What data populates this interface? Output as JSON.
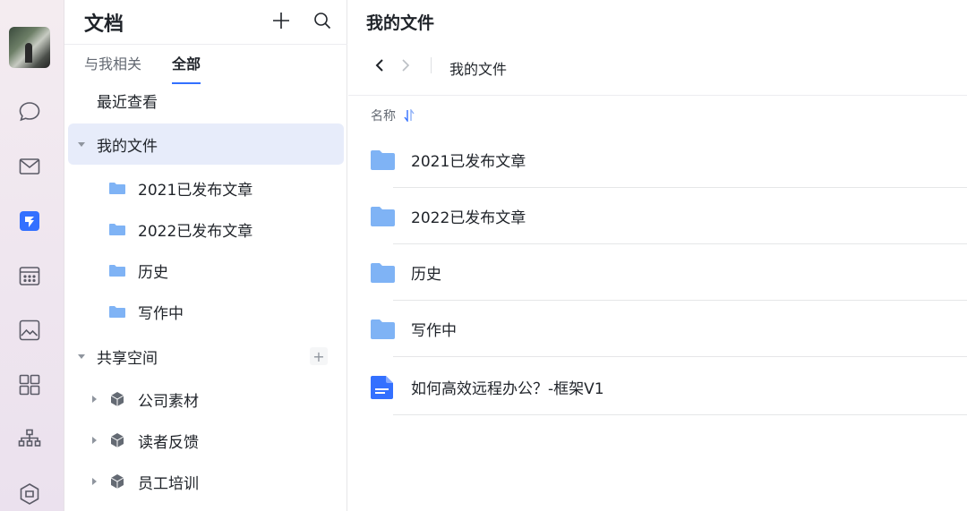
{
  "sidebar": {
    "title": "文档",
    "tabs": [
      {
        "label": "与我相关"
      },
      {
        "label": "全部"
      }
    ],
    "recent": "最近查看",
    "my_files": "我的文件",
    "folders": [
      {
        "label": "2021已发布文章"
      },
      {
        "label": "2022已发布文章"
      },
      {
        "label": "历史"
      },
      {
        "label": "写作中"
      }
    ],
    "shared_space": "共享空间",
    "shared_add": "+",
    "spaces": [
      {
        "label": "公司素材"
      },
      {
        "label": "读者反馈"
      },
      {
        "label": "员工培训"
      }
    ]
  },
  "main": {
    "title": "我的文件",
    "breadcrumb": "我的文件",
    "column_header": "名称",
    "files": [
      {
        "name": "2021已发布文章",
        "type": "folder"
      },
      {
        "name": "2022已发布文章",
        "type": "folder"
      },
      {
        "name": "历史",
        "type": "folder"
      },
      {
        "name": "写作中",
        "type": "folder"
      },
      {
        "name": "如何高效远程办公？-框架V1",
        "type": "doc"
      }
    ]
  },
  "colors": {
    "accent": "#3370ff",
    "folder": "#7fb3f5",
    "selected_bg": "#e7ecfa"
  },
  "rail_icons": [
    "chat-icon",
    "mail-icon",
    "docs-icon",
    "calendar-icon",
    "gallery-icon",
    "apps-icon",
    "org-chart-icon",
    "workspace-icon"
  ]
}
